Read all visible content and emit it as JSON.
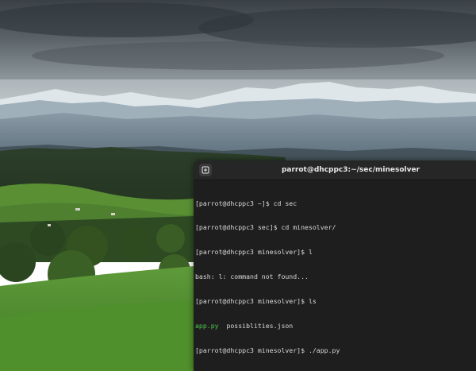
{
  "terminal": {
    "title": "parrot@dhcppc3:~/sec/minesolver",
    "new_tab_icon": "new-tab-icon",
    "lines": [
      "[parrot@dhcppc3 ~]$ cd sec",
      "[parrot@dhcppc3 sec]$ cd minesolver/",
      "[parrot@dhcppc3 minesolver]$ l",
      "bash: l: command not found...",
      "[parrot@dhcppc3 minesolver]$ ls"
    ],
    "ls_output": {
      "file1": "app.py",
      "file2": "possiblities.json"
    },
    "last_line": "[parrot@dhcppc3 minesolver]$ ./app.py",
    "colors": {
      "background": "#1e1e1e",
      "titlebar": "#262626",
      "text": "#d8d8d8",
      "executable": "#4ec94e"
    }
  },
  "wallpaper": {
    "description_icon": "mountain-landscape-wallpaper"
  }
}
